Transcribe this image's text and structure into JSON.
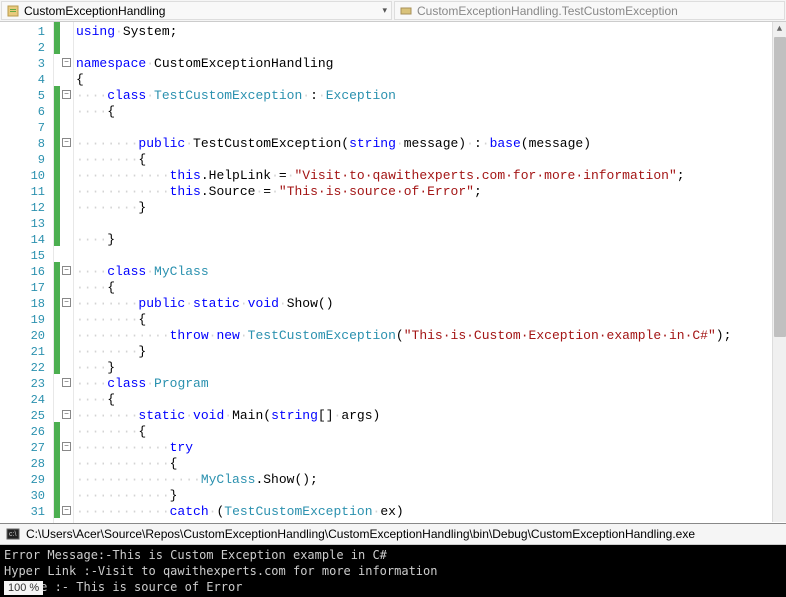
{
  "nav": {
    "left": "CustomExceptionHandling",
    "right": "CustomExceptionHandling.TestCustomException"
  },
  "code_lines": [
    {
      "n": 1,
      "change": true,
      "fold": "",
      "segs": [
        {
          "c": "kw",
          "t": "using"
        },
        {
          "c": "ws",
          "t": "·"
        },
        {
          "c": "plain",
          "t": "System;"
        }
      ]
    },
    {
      "n": 2,
      "change": true,
      "fold": "",
      "segs": []
    },
    {
      "n": 3,
      "change": false,
      "fold": "-",
      "segs": [
        {
          "c": "kw",
          "t": "namespace"
        },
        {
          "c": "ws",
          "t": "·"
        },
        {
          "c": "plain",
          "t": "CustomExceptionHandling"
        }
      ]
    },
    {
      "n": 4,
      "change": false,
      "fold": "",
      "segs": [
        {
          "c": "plain",
          "t": "{"
        }
      ]
    },
    {
      "n": 5,
      "change": true,
      "fold": "-",
      "segs": [
        {
          "c": "ws",
          "t": "····"
        },
        {
          "c": "kw",
          "t": "class"
        },
        {
          "c": "ws",
          "t": "·"
        },
        {
          "c": "type",
          "t": "TestCustomException"
        },
        {
          "c": "ws",
          "t": "·"
        },
        {
          "c": "plain",
          "t": ":"
        },
        {
          "c": "ws",
          "t": "·"
        },
        {
          "c": "type",
          "t": "Exception"
        }
      ]
    },
    {
      "n": 6,
      "change": true,
      "fold": "",
      "segs": [
        {
          "c": "ws",
          "t": "····"
        },
        {
          "c": "plain",
          "t": "{"
        }
      ]
    },
    {
      "n": 7,
      "change": true,
      "fold": "",
      "segs": []
    },
    {
      "n": 8,
      "change": true,
      "fold": "-",
      "segs": [
        {
          "c": "ws",
          "t": "········"
        },
        {
          "c": "kw",
          "t": "public"
        },
        {
          "c": "ws",
          "t": "·"
        },
        {
          "c": "plain",
          "t": "TestCustomException("
        },
        {
          "c": "kw",
          "t": "string"
        },
        {
          "c": "ws",
          "t": "·"
        },
        {
          "c": "plain",
          "t": "message)"
        },
        {
          "c": "ws",
          "t": "·"
        },
        {
          "c": "plain",
          "t": ":"
        },
        {
          "c": "ws",
          "t": "·"
        },
        {
          "c": "kw",
          "t": "base"
        },
        {
          "c": "plain",
          "t": "(message)"
        }
      ]
    },
    {
      "n": 9,
      "change": true,
      "fold": "",
      "segs": [
        {
          "c": "ws",
          "t": "········"
        },
        {
          "c": "plain",
          "t": "{"
        }
      ]
    },
    {
      "n": 10,
      "change": true,
      "fold": "",
      "segs": [
        {
          "c": "ws",
          "t": "············"
        },
        {
          "c": "kw",
          "t": "this"
        },
        {
          "c": "plain",
          "t": ".HelpLink"
        },
        {
          "c": "ws",
          "t": "·"
        },
        {
          "c": "plain",
          "t": "="
        },
        {
          "c": "ws",
          "t": "·"
        },
        {
          "c": "str",
          "t": "\"Visit·to·qawithexperts.com·for·more·information\""
        },
        {
          "c": "plain",
          "t": ";"
        }
      ]
    },
    {
      "n": 11,
      "change": true,
      "fold": "",
      "segs": [
        {
          "c": "ws",
          "t": "············"
        },
        {
          "c": "kw",
          "t": "this"
        },
        {
          "c": "plain",
          "t": ".Source"
        },
        {
          "c": "ws",
          "t": "·"
        },
        {
          "c": "plain",
          "t": "="
        },
        {
          "c": "ws",
          "t": "·"
        },
        {
          "c": "str",
          "t": "\"This·is·source·of·Error\""
        },
        {
          "c": "plain",
          "t": ";"
        }
      ]
    },
    {
      "n": 12,
      "change": true,
      "fold": "",
      "segs": [
        {
          "c": "ws",
          "t": "········"
        },
        {
          "c": "plain",
          "t": "}"
        }
      ]
    },
    {
      "n": 13,
      "change": true,
      "fold": "",
      "segs": []
    },
    {
      "n": 14,
      "change": true,
      "fold": "",
      "segs": [
        {
          "c": "ws",
          "t": "····"
        },
        {
          "c": "plain",
          "t": "}"
        }
      ]
    },
    {
      "n": 15,
      "change": false,
      "fold": "",
      "segs": []
    },
    {
      "n": 16,
      "change": true,
      "fold": "-",
      "segs": [
        {
          "c": "ws",
          "t": "····"
        },
        {
          "c": "kw",
          "t": "class"
        },
        {
          "c": "ws",
          "t": "·"
        },
        {
          "c": "type",
          "t": "MyClass"
        }
      ]
    },
    {
      "n": 17,
      "change": true,
      "fold": "",
      "segs": [
        {
          "c": "ws",
          "t": "····"
        },
        {
          "c": "plain",
          "t": "{"
        }
      ]
    },
    {
      "n": 18,
      "change": true,
      "fold": "-",
      "segs": [
        {
          "c": "ws",
          "t": "········"
        },
        {
          "c": "kw",
          "t": "public"
        },
        {
          "c": "ws",
          "t": "·"
        },
        {
          "c": "kw",
          "t": "static"
        },
        {
          "c": "ws",
          "t": "·"
        },
        {
          "c": "kw",
          "t": "void"
        },
        {
          "c": "ws",
          "t": "·"
        },
        {
          "c": "plain",
          "t": "Show()"
        }
      ]
    },
    {
      "n": 19,
      "change": true,
      "fold": "",
      "segs": [
        {
          "c": "ws",
          "t": "········"
        },
        {
          "c": "plain",
          "t": "{"
        }
      ]
    },
    {
      "n": 20,
      "change": true,
      "fold": "",
      "segs": [
        {
          "c": "ws",
          "t": "············"
        },
        {
          "c": "kw",
          "t": "throw"
        },
        {
          "c": "ws",
          "t": "·"
        },
        {
          "c": "kw",
          "t": "new"
        },
        {
          "c": "ws",
          "t": "·"
        },
        {
          "c": "type",
          "t": "TestCustomException"
        },
        {
          "c": "plain",
          "t": "("
        },
        {
          "c": "str",
          "t": "\"This·is·Custom·Exception·example·in·C#\""
        },
        {
          "c": "plain",
          "t": ");"
        }
      ]
    },
    {
      "n": 21,
      "change": true,
      "fold": "",
      "segs": [
        {
          "c": "ws",
          "t": "········"
        },
        {
          "c": "plain",
          "t": "}"
        }
      ]
    },
    {
      "n": 22,
      "change": true,
      "fold": "",
      "segs": [
        {
          "c": "ws",
          "t": "····"
        },
        {
          "c": "plain",
          "t": "}"
        }
      ]
    },
    {
      "n": 23,
      "change": false,
      "fold": "-",
      "segs": [
        {
          "c": "ws",
          "t": "····"
        },
        {
          "c": "kw",
          "t": "class"
        },
        {
          "c": "ws",
          "t": "·"
        },
        {
          "c": "type",
          "t": "Program"
        }
      ]
    },
    {
      "n": 24,
      "change": false,
      "fold": "",
      "segs": [
        {
          "c": "ws",
          "t": "····"
        },
        {
          "c": "plain",
          "t": "{"
        }
      ]
    },
    {
      "n": 25,
      "change": false,
      "fold": "-",
      "segs": [
        {
          "c": "ws",
          "t": "········"
        },
        {
          "c": "kw",
          "t": "static"
        },
        {
          "c": "ws",
          "t": "·"
        },
        {
          "c": "kw",
          "t": "void"
        },
        {
          "c": "ws",
          "t": "·"
        },
        {
          "c": "plain",
          "t": "Main("
        },
        {
          "c": "kw",
          "t": "string"
        },
        {
          "c": "plain",
          "t": "[]"
        },
        {
          "c": "ws",
          "t": "·"
        },
        {
          "c": "plain",
          "t": "args)"
        }
      ]
    },
    {
      "n": 26,
      "change": true,
      "fold": "",
      "segs": [
        {
          "c": "ws",
          "t": "········"
        },
        {
          "c": "plain",
          "t": "{"
        }
      ]
    },
    {
      "n": 27,
      "change": true,
      "fold": "-",
      "segs": [
        {
          "c": "ws",
          "t": "············"
        },
        {
          "c": "kw",
          "t": "try"
        }
      ]
    },
    {
      "n": 28,
      "change": true,
      "fold": "",
      "segs": [
        {
          "c": "ws",
          "t": "············"
        },
        {
          "c": "plain",
          "t": "{"
        }
      ]
    },
    {
      "n": 29,
      "change": true,
      "fold": "",
      "segs": [
        {
          "c": "ws",
          "t": "················"
        },
        {
          "c": "type",
          "t": "MyClass"
        },
        {
          "c": "plain",
          "t": ".Show();"
        }
      ]
    },
    {
      "n": 30,
      "change": true,
      "fold": "",
      "segs": [
        {
          "c": "ws",
          "t": "············"
        },
        {
          "c": "plain",
          "t": "}"
        }
      ]
    },
    {
      "n": 31,
      "change": true,
      "fold": "-",
      "segs": [
        {
          "c": "ws",
          "t": "············"
        },
        {
          "c": "kw",
          "t": "catch"
        },
        {
          "c": "ws",
          "t": "·"
        },
        {
          "c": "plain",
          "t": "("
        },
        {
          "c": "type",
          "t": "TestCustomException"
        },
        {
          "c": "ws",
          "t": "·"
        },
        {
          "c": "plain",
          "t": "ex)"
        }
      ]
    }
  ],
  "console": {
    "title": "C:\\Users\\Acer\\Source\\Repos\\CustomExceptionHandling\\CustomExceptionHandling\\bin\\Debug\\CustomExceptionHandling.exe",
    "lines": [
      "Error Message:-This is Custom Exception example in C#",
      "Hyper Link :-Visit to qawithexperts.com for more information",
      "Source :- This is source of Error"
    ]
  },
  "zoom": "100 %"
}
